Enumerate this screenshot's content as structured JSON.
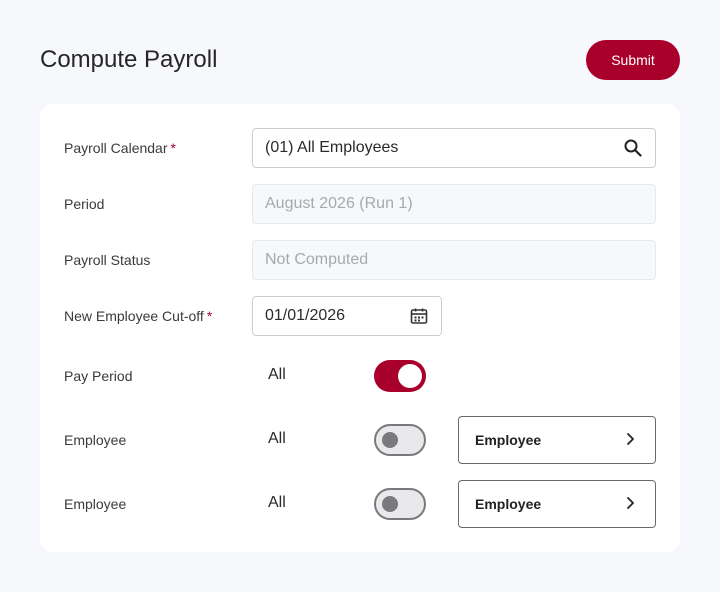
{
  "header": {
    "title": "Compute Payroll",
    "submit_label": "Submit"
  },
  "form": {
    "payroll_calendar": {
      "label": "Payroll Calendar",
      "required_mark": "*",
      "value": "(01) All Employees",
      "icon": "search-icon"
    },
    "period": {
      "label": "Period",
      "value": "August 2026 (Run 1)"
    },
    "payroll_status": {
      "label": "Payroll Status",
      "value": "Not Computed"
    },
    "cutoff": {
      "label": "New Employee Cut-off",
      "required_mark": "*",
      "value": "01/01/2026",
      "icon": "calendar-icon"
    },
    "pay_period": {
      "label": "Pay Period",
      "all_text": "All",
      "toggle_on": true
    },
    "employee_rows": [
      {
        "label": "Employee",
        "all_text": "All",
        "toggle_on": false,
        "button_label": "Employee"
      },
      {
        "label": "Employee",
        "all_text": "All",
        "toggle_on": false,
        "button_label": "Employee"
      }
    ]
  },
  "colors": {
    "accent": "#a8002a",
    "background": "#f7f8fc",
    "card": "#ffffff"
  }
}
